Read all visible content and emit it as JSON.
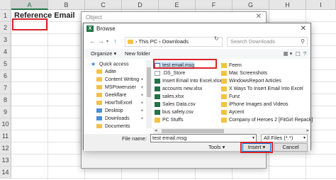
{
  "sheet": {
    "columns": [
      "A",
      "B",
      "C",
      "D",
      "E",
      "F",
      "G",
      "H",
      "I"
    ],
    "rows": [
      "1",
      "2",
      "3",
      "4",
      "5",
      "6",
      "7",
      "8",
      "9",
      "10",
      "11",
      "12",
      "13",
      "14"
    ],
    "a1": "Reference Email"
  },
  "object_dialog": {
    "title": "Object",
    "close": "✕"
  },
  "browse": {
    "title": "Browse",
    "close": "✕",
    "breadcrumb": [
      "This PC",
      "Downloads"
    ],
    "search_placeholder": "Search Downloads",
    "organize": "Organize ▾",
    "new_folder": "New folder",
    "nav_items": [
      {
        "label": "Quick access",
        "icon": "star-icon"
      },
      {
        "label": "Adite",
        "icon": "folder-icon"
      },
      {
        "label": "Content Writing",
        "icon": "folder-icon"
      },
      {
        "label": "MSPoweruser",
        "icon": "folder-icon"
      },
      {
        "label": "Geekflare",
        "icon": "folder-icon"
      },
      {
        "label": "HowToExcel",
        "icon": "folder-icon"
      },
      {
        "label": "Desktop",
        "icon": "folder-icon"
      },
      {
        "label": "Downloads",
        "icon": "folder-icon"
      },
      {
        "label": "Documents",
        "icon": "folder-icon"
      }
    ],
    "files_col1": [
      {
        "name": "test email.msg",
        "icon": "msg"
      },
      {
        "name": ".DS_Store",
        "icon": "doc"
      },
      {
        "name": "Insert Email Into Excel.xlsx",
        "icon": "xl"
      },
      {
        "name": "accounts new.xlsx",
        "icon": "xl"
      },
      {
        "name": "sales.xlsx",
        "icon": "xl"
      },
      {
        "name": "Sales Data.csv",
        "icon": "xl"
      },
      {
        "name": "bus safety.csv",
        "icon": "xl"
      },
      {
        "name": "PC Stuffs",
        "icon": "fold"
      }
    ],
    "files_col2": [
      {
        "name": "Feem",
        "icon": "fold"
      },
      {
        "name": "Mac Screenshots",
        "icon": "fold"
      },
      {
        "name": "WindowsReport Articles",
        "icon": "fold"
      },
      {
        "name": "X Ways To Insert Email Into Excel",
        "icon": "fold"
      },
      {
        "name": "Funz",
        "icon": "fold"
      },
      {
        "name": "iPhone Images and Videos",
        "icon": "fold"
      },
      {
        "name": "Aycent",
        "icon": "fold"
      },
      {
        "name": "Company of Heroes 2 [FitGirl Repack]",
        "icon": "fold"
      }
    ],
    "file_name_label": "File name:",
    "file_name_value": "test email.msg",
    "file_type": "All Files (*.*)",
    "tools": "Tools",
    "insert": "Insert",
    "cancel": "Cancel"
  }
}
